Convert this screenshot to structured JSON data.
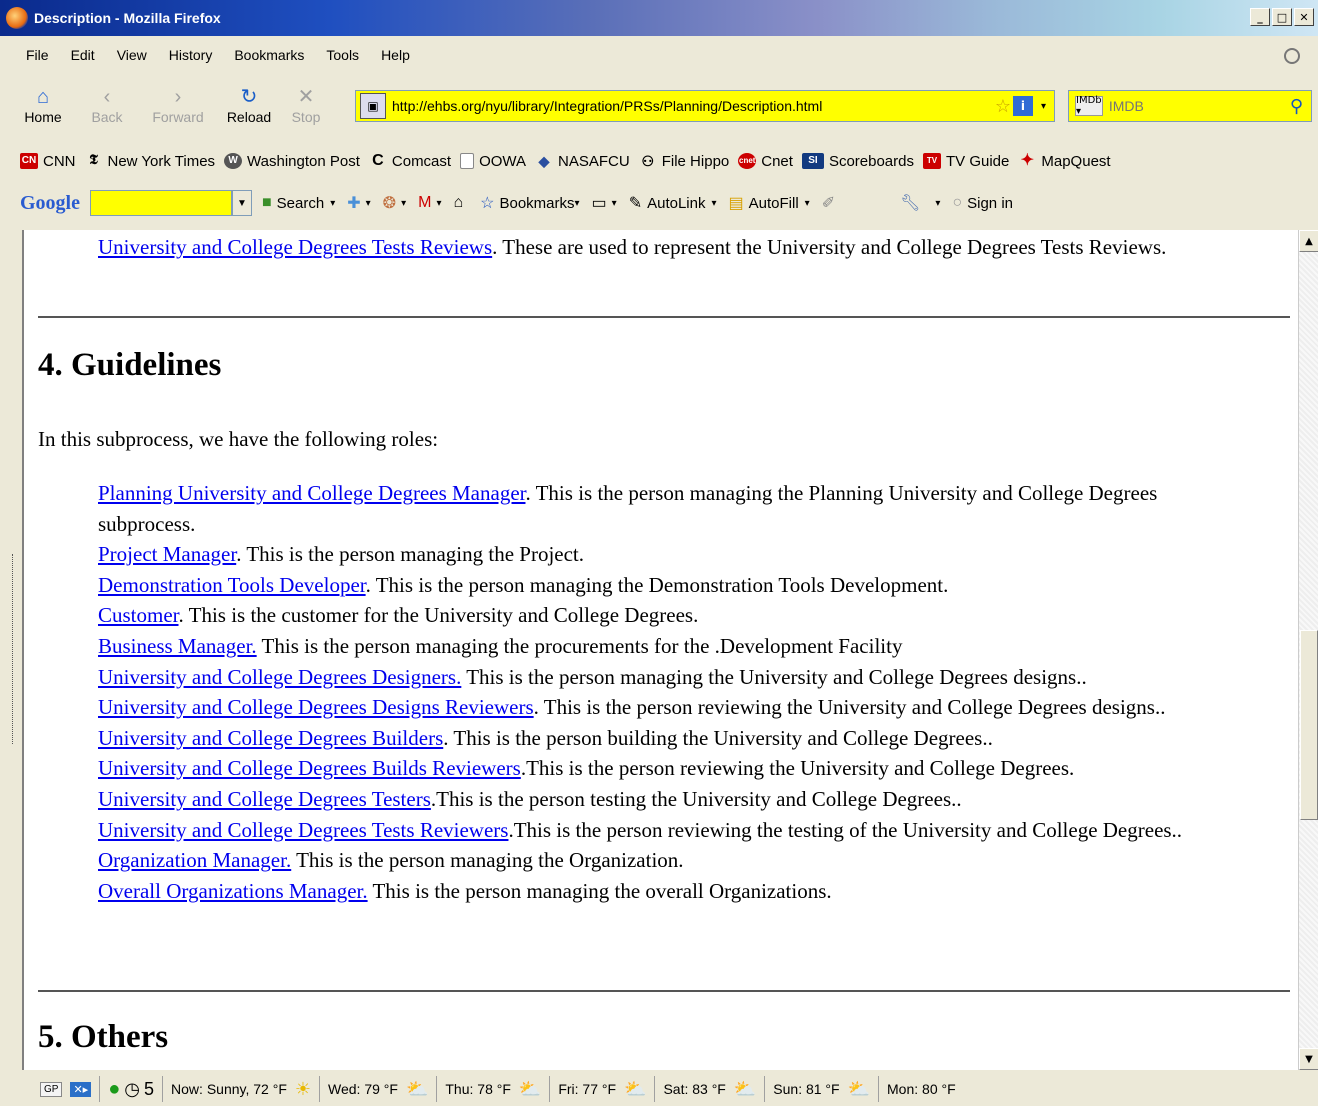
{
  "window": {
    "title": "Description - Mozilla Firefox"
  },
  "menu": [
    "File",
    "Edit",
    "View",
    "History",
    "Bookmarks",
    "Tools",
    "Help"
  ],
  "nav": {
    "home": "Home",
    "back": "Back",
    "forward": "Forward",
    "reload": "Reload",
    "stop": "Stop"
  },
  "address": {
    "url": "http://ehbs.org/nyu/library/Integration/PRSs/Planning/Description.html"
  },
  "search": {
    "placeholder": "IMDB"
  },
  "bookmarks": [
    "CNN",
    "New York Times",
    "Washington Post",
    "Comcast",
    "OOWA",
    "NASAFCU",
    "File Hippo",
    "Cnet",
    "Scoreboards",
    "TV Guide",
    "MapQuest"
  ],
  "google_toolbar": {
    "logo": "Google",
    "search": "Search",
    "bookmarks": "Bookmarks",
    "autolink": "AutoLink",
    "autofill": "AutoFill",
    "signin": "Sign in"
  },
  "page": {
    "top_link": "University and College Degrees Tests Reviews",
    "top_text": ". These are used to represent the University and College Degrees Tests Reviews.",
    "h4": "4. Guidelines",
    "intro": "In this subprocess, we have the following roles:",
    "roles": [
      {
        "link": "Planning University and College Degrees Manager",
        "text": ". This is the person managing the Planning University and College Degrees subprocess."
      },
      {
        "link": "Project Manager",
        "text": ". This is the person managing the Project."
      },
      {
        "link": "Demonstration Tools Developer",
        "text": ". This is the person managing the Demonstration Tools Development."
      },
      {
        "link": "Customer",
        "text": ". This is the customer for the University and College Degrees."
      },
      {
        "link": "Business Manager.",
        "text": " This is the person managing the procurements for the .Development Facility"
      },
      {
        "link": "University and College Degrees Designers.",
        "text": " This is the person managing the University and College Degrees designs.."
      },
      {
        "link": "University and College Degrees Designs Reviewers",
        "text": ". This is the person reviewing the University and College Degrees designs.."
      },
      {
        "link": "University and College Degrees Builders",
        "text": ". This is the person building the University and College Degrees.."
      },
      {
        "link": "University and College Degrees Builds Reviewers",
        "text": ".This is the person reviewing the University and College Degrees."
      },
      {
        "link": "University and College Degrees Testers",
        "text": ".This is the person testing the University and College Degrees.."
      },
      {
        "link": "University and College Degrees Tests Reviewers",
        "text": ".This is the person reviewing the testing of the University and College Degrees.."
      },
      {
        "link": "Organization Manager.",
        "text": " This is the person managing the Organization."
      },
      {
        "link": "Overall Organizations Manager.",
        "text": " This is the person managing the overall Organizations."
      }
    ],
    "h5": "5. Others"
  },
  "status": {
    "gp": "GP",
    "counter": "5",
    "weather": [
      {
        "label": "Now: Sunny, 72 °F",
        "icon": "sun-icon"
      },
      {
        "label": "Wed: 79 °F",
        "icon": "partly-cloudy-icon"
      },
      {
        "label": "Thu: 78 °F",
        "icon": "partly-cloudy-icon"
      },
      {
        "label": "Fri: 77 °F",
        "icon": "partly-cloudy-icon"
      },
      {
        "label": "Sat: 83 °F",
        "icon": "partly-cloudy-icon"
      },
      {
        "label": "Sun: 81 °F",
        "icon": "partly-cloudy-icon"
      },
      {
        "label": "Mon: 80 °F",
        "icon": "partly-cloudy-icon"
      }
    ]
  }
}
